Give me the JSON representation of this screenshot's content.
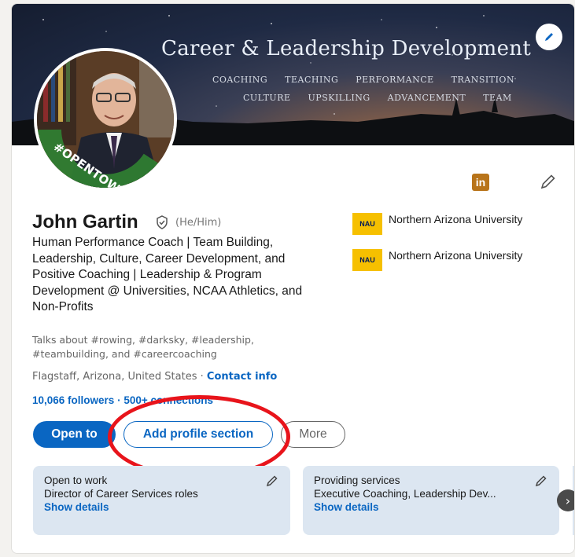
{
  "banner": {
    "title": "Career & Leadership Development",
    "tags_row1": [
      "COACHING",
      "TEACHING",
      "PERFORMANCE",
      "TRANSITION"
    ],
    "tags_row2": [
      "CULTURE",
      "UPSKILLING",
      "ADVANCEMENT",
      "TEAM"
    ]
  },
  "avatar": {
    "frame_text": "#OPENTOWORK"
  },
  "profile": {
    "name": "John Gartin",
    "pronouns": "(He/Him)",
    "headline": "Human Performance Coach | Team Building, Leadership, Culture, Career Development, and Positive Coaching | Leadership & Program Development @ Universities, NCAA Athletics, and Non-Profits",
    "talks_about": "Talks about #rowing, #darksky, #leadership, #teambuilding, and #careercoaching",
    "location": "Flagstaff, Arizona, United States",
    "location_sep": " · ",
    "contact_info": "Contact info",
    "followers": "10,066 followers",
    "followers_sep": " · ",
    "connections": "500+ connections"
  },
  "schools": [
    {
      "logo": "NAU",
      "name": "Northern Arizona University"
    },
    {
      "logo": "NAU",
      "name": "Northern Arizona University"
    }
  ],
  "linkedin_badge": "in",
  "actions": {
    "open_to": "Open to",
    "add_section": "Add profile section",
    "more": "More"
  },
  "panels": [
    {
      "title": "Open to work",
      "desc": "Director of Career Services roles",
      "link": "Show details"
    },
    {
      "title": "Providing services",
      "desc": "Executive Coaching, Leadership Dev...",
      "link": "Show details"
    }
  ],
  "colors": {
    "accent": "#0a66c2",
    "annotation": "#e8141b",
    "panel_bg": "#dce6f1",
    "opentowork": "#2f7d32"
  }
}
